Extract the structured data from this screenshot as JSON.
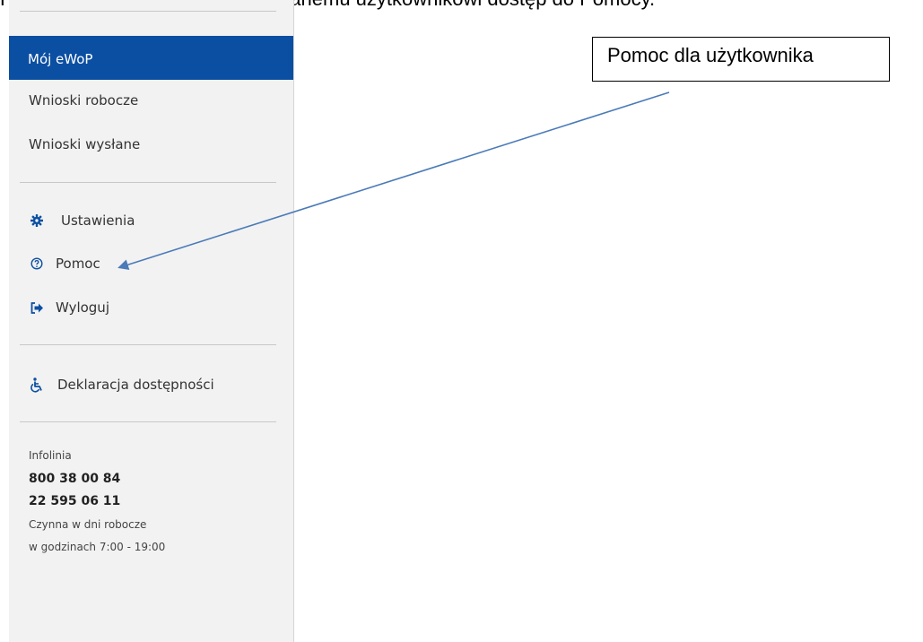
{
  "caption": "Portal eWoP udostępnia zalogowanemu użytkownikowi dostęp do Pomocy.",
  "sidebar": {
    "active_item": "Mój eWoP",
    "items": [
      {
        "label": "Wnioski robocze"
      },
      {
        "label": "Wnioski wysłane"
      }
    ],
    "actions": [
      {
        "label": "Ustawienia",
        "icon": "gear-icon"
      },
      {
        "label": "Pomoc",
        "icon": "help-circle-icon"
      },
      {
        "label": "Wyloguj",
        "icon": "logout-icon"
      }
    ],
    "accessibility": {
      "label": "Deklaracja dostępności",
      "icon": "wheelchair-icon"
    },
    "hotline": {
      "title": "Infolinia",
      "phone1": "800 38 00 84",
      "phone2": "22 595 06 11",
      "hours_line1": "Czynna w dni robocze",
      "hours_line2": "w godzinach 7:00 - 19:00"
    }
  },
  "callout": {
    "text": "Pomoc dla użytkownika"
  },
  "colors": {
    "accent": "#0b4fa2",
    "sidebar_bg": "#f2f2f2",
    "arrow": "#4a7ab8"
  }
}
